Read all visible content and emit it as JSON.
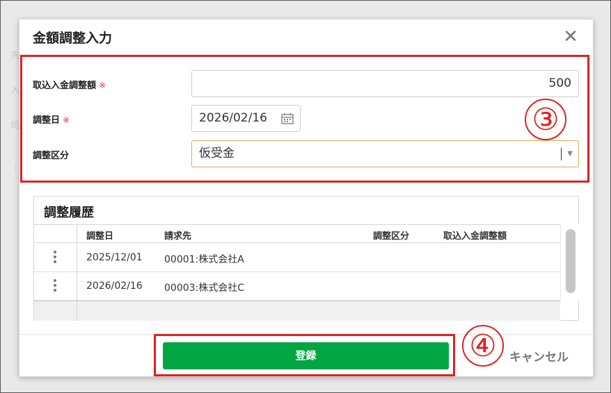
{
  "background": {
    "ghost_labels": [
      "先",
      "入",
      "処",
      "｜"
    ]
  },
  "dialog": {
    "title": "金額調整入力",
    "close_glyph": "✕"
  },
  "form": {
    "amount": {
      "label": "取込入金調整額",
      "required_mark": "※",
      "value": "500"
    },
    "date": {
      "label": "調整日",
      "required_mark": "※",
      "value": "2026/02/16"
    },
    "category": {
      "label": "調整区分",
      "value": "仮受金"
    }
  },
  "annotations": {
    "step3": "③",
    "step4": "④",
    "color": "#e02020"
  },
  "history": {
    "title": "調整履歴",
    "columns": [
      "調整日",
      "請求先",
      "調整区分",
      "取込入金調整額"
    ],
    "rows": [
      {
        "date": "2025/12/01",
        "customer": "00001:株式会社A",
        "category": "",
        "amount": ""
      },
      {
        "date": "2026/02/16",
        "customer": "00003:株式会社C",
        "category": "",
        "amount": ""
      }
    ]
  },
  "footer": {
    "save_label": "登録",
    "cancel_label": "キャンセル"
  },
  "colors": {
    "primary_green": "#00a642",
    "required_red": "#e0304a",
    "select_focus": "#e3a852"
  },
  "icons": [
    "close-icon",
    "calendar-icon",
    "dropdown-arrow-icon",
    "kebab-menu-icon"
  ]
}
